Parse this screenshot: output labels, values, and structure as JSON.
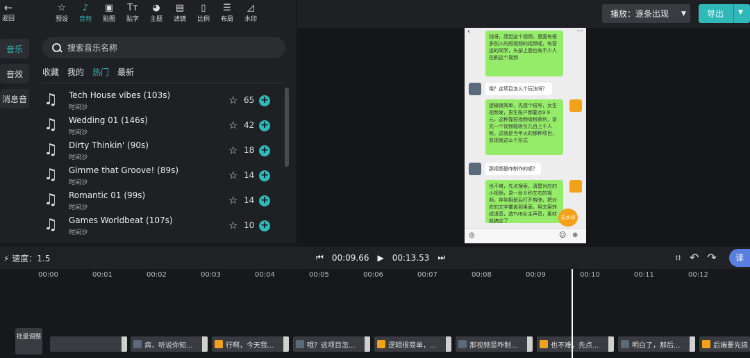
{
  "toolbar": {
    "back_label": "返回",
    "tools": [
      {
        "icon": "star-icon",
        "label": "预设"
      },
      {
        "icon": "music-note-icon",
        "label": "音频"
      },
      {
        "icon": "sticker-icon",
        "label": "贴图"
      },
      {
        "icon": "text-icon",
        "label": "贴字"
      },
      {
        "icon": "palette-icon",
        "label": "主题"
      },
      {
        "icon": "filter-icon",
        "label": "滤镜"
      },
      {
        "icon": "ratio-icon",
        "label": "比例"
      },
      {
        "icon": "layout-icon",
        "label": "布局"
      },
      {
        "icon": "watermark-icon",
        "label": "水印"
      }
    ]
  },
  "sidebar": {
    "tabs": [
      "音乐",
      "音效",
      "消息音"
    ]
  },
  "search": {
    "placeholder": "搜索音乐名称"
  },
  "categories": [
    "收藏",
    "我的",
    "热门",
    "最新"
  ],
  "tracks": [
    {
      "title": "Tech House vibes (103s)",
      "artist": "时间沙",
      "count": "65"
    },
    {
      "title": "Wedding 01 (146s)",
      "artist": "时间沙",
      "count": "42"
    },
    {
      "title": "Dirty Thinkin' (90s)",
      "artist": "时间沙",
      "count": "18"
    },
    {
      "title": "Gimme that Groove! (89s)",
      "artist": "时间沙",
      "count": "14"
    },
    {
      "title": "Romantic 01 (99s)",
      "artist": "时间沙",
      "count": "14"
    },
    {
      "title": "Games Worldbeat (107s)",
      "artist": "时间沙",
      "count": "10"
    }
  ],
  "header": {
    "playmode_label": "播放：逐条出现",
    "export_label": "导出"
  },
  "phone": {
    "bubbles": [
      "钱呀，感觉这个视频，里面有很多别人的短视频的视频呢，有营运的同学，头部上面也有不少人在刷这个视频",
      "哦？这项目怎么个玩法呀？",
      "逻辑很简单，先建个短号，女生视频发，男生账户都要点9.9元，这种靠短视频吸粉获利，讲究一个视频能吸引几百上千人呢，这就是当年火的那种项目，变现就这么个形式",
      "那视频是咋制作的呢？",
      "也不难，先点搜索，清楚对应的小视频，录一段８秒左右的视频，存到相册后打开剪映，把对应的文字覆盖到里面，用文案转成语音，选TVB女主声音，素材就搞定了"
    ],
    "watermark_label": "去水印"
  },
  "timeline": {
    "speed_label": "速度：1.5",
    "current_time": "00:09.66",
    "total_time": "00:13.53",
    "badge": "译",
    "ruler": [
      "00:00",
      "00:01",
      "00:02",
      "00:03",
      "00:04",
      "00:05",
      "00:06",
      "00:07",
      "00:08",
      "00:09",
      "00:10",
      "00:11",
      "00:12"
    ],
    "cc_label": "批量调整",
    "clips": [
      "",
      "病，听说你知...",
      "行啊，今天我...",
      "哦？这项目怎...",
      "逻辑很简单，...",
      "那视频是咋制...",
      "也不难，先点...",
      "明白了，那后...",
      "后端要先搞"
    ]
  }
}
